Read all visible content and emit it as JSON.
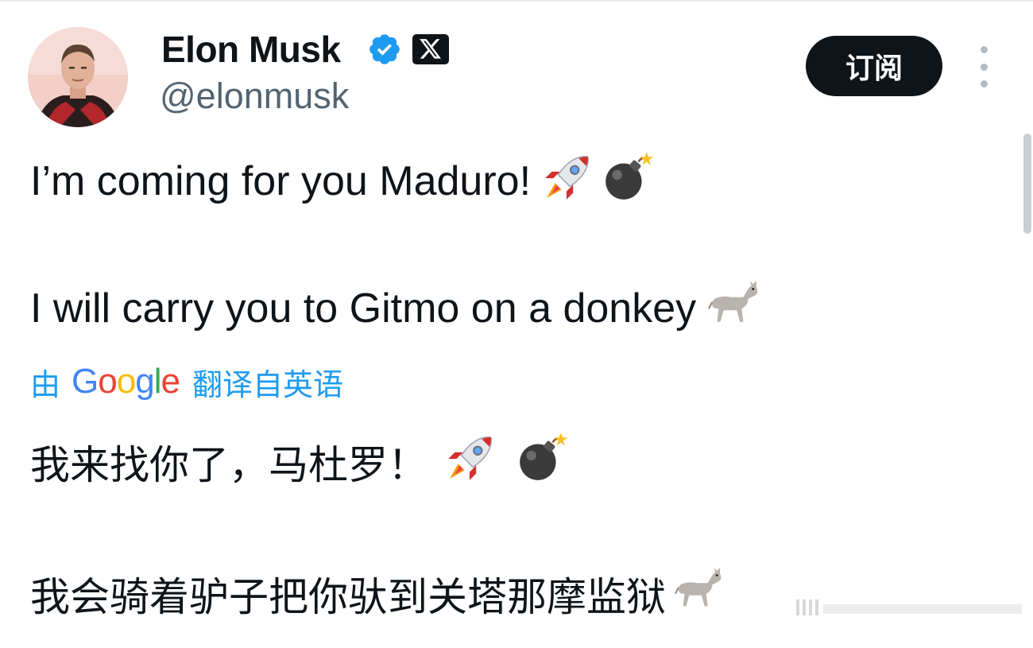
{
  "author": {
    "display_name": "Elon Musk",
    "handle": "@elonmusk",
    "verified": true,
    "avatar_icon": "profile-photo",
    "badge_icon": "x-logo-badge"
  },
  "actions": {
    "subscribe_label": "订阅",
    "more_icon": "more-vertical-icon"
  },
  "tweet": {
    "line1": "I’m coming for you Maduro!",
    "line2": "I will carry you to Gitmo on a donkey",
    "line1_emojis": [
      "rocket",
      "bomb"
    ],
    "line2_emojis": [
      "donkey"
    ]
  },
  "translation": {
    "prefix": "由",
    "provider": "Google",
    "suffix": "翻译自英语",
    "line1": "我来找你了，马杜罗！",
    "line2": "我会骑着驴子把你驮到关塔那摩监狱"
  },
  "colors": {
    "text": "#0f1419",
    "secondary": "#536471",
    "link": "#1d9bf0",
    "verified": "#1d9bf0",
    "button_bg": "#0f1419",
    "google_blue": "#4285f4",
    "google_red": "#ea4335",
    "google_yellow": "#fbbc05",
    "google_green": "#34a853"
  }
}
